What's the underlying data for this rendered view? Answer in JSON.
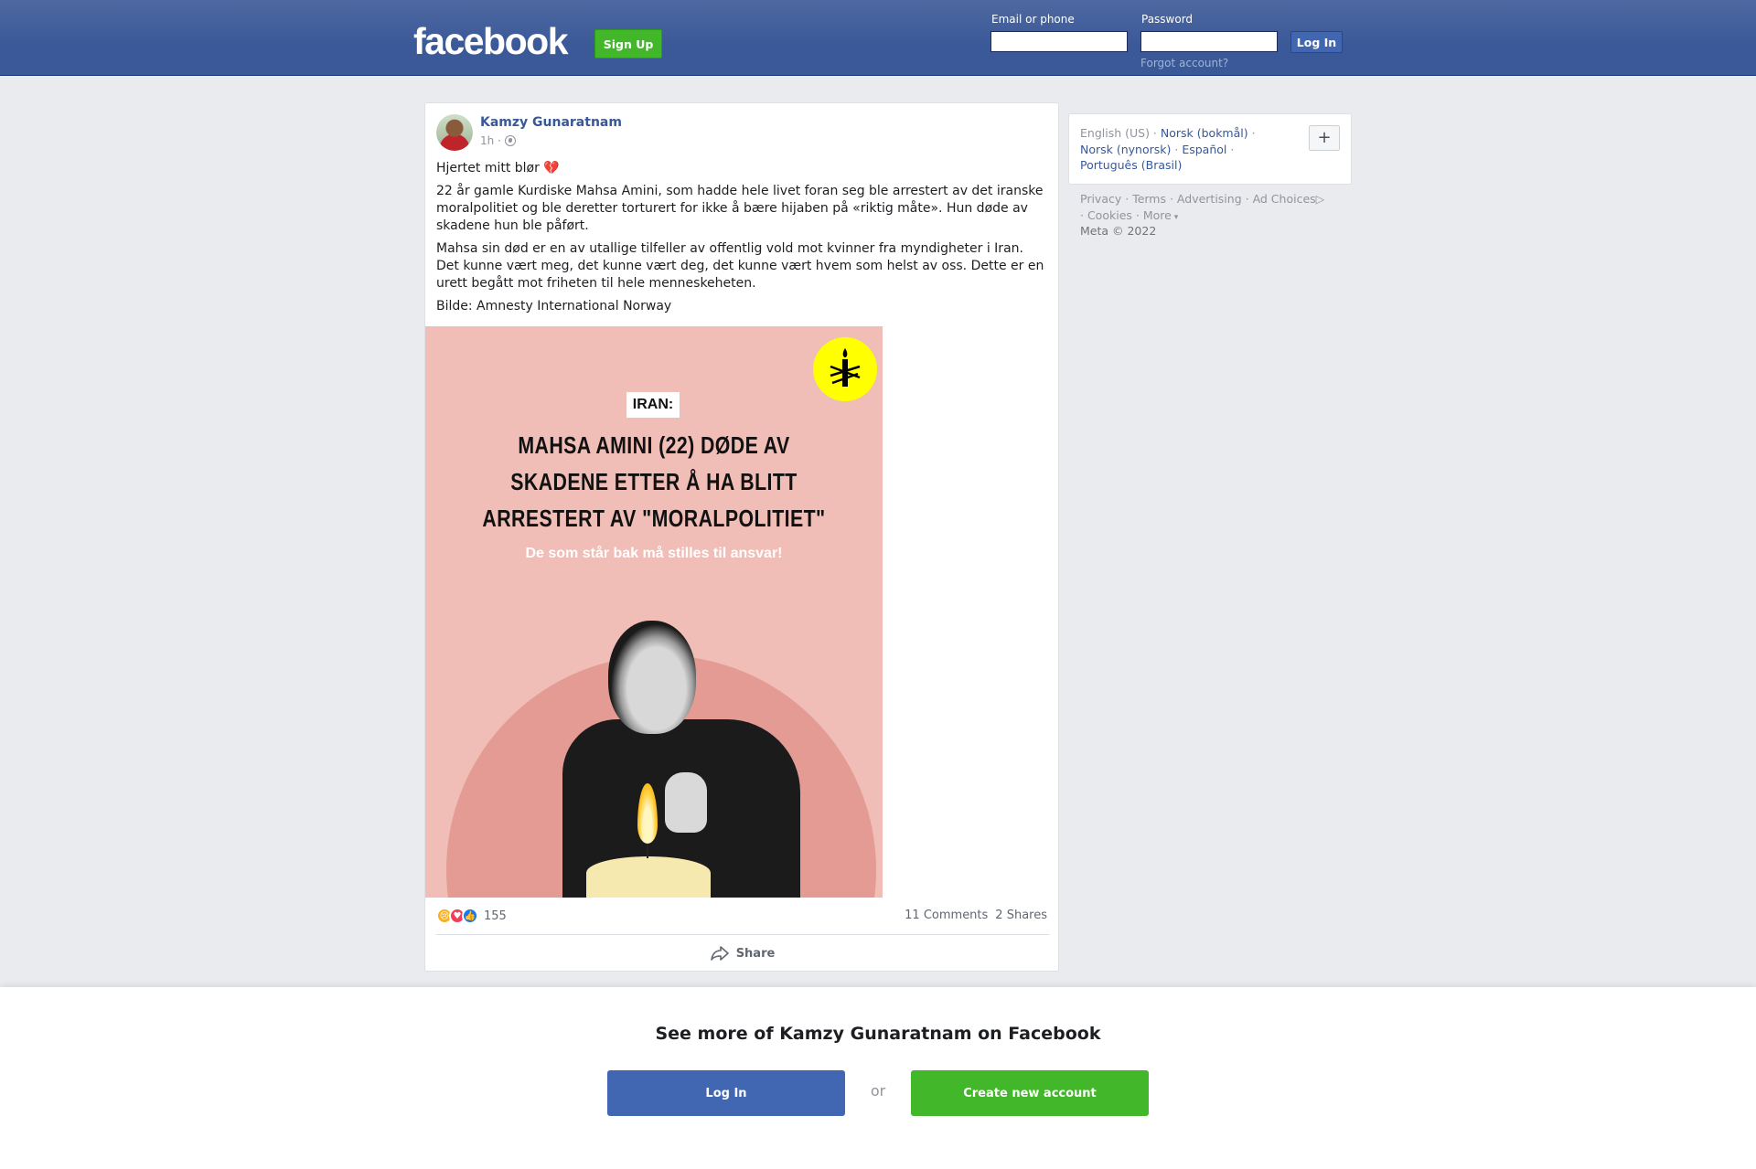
{
  "header": {
    "logo": "facebook",
    "signup_label": "Sign Up",
    "email_label": "Email or phone",
    "password_label": "Password",
    "login_label": "Log In",
    "forgot_label": "Forgot account?"
  },
  "post": {
    "author": "Kamzy Gunaratnam",
    "time": "1h ·",
    "paragraphs": [
      "Hjertet mitt blør 💔",
      "22 år gamle Kurdiske Mahsa Amini, som hadde hele livet foran seg ble arrestert av det iranske moralpolitiet og ble deretter torturert for ikke å bære hijaben på «riktig måte». Hun døde av skadene hun ble påført.",
      "Mahsa sin død er en av utallige tilfeller av offentlig vold mot kvinner fra myndigheter i Iran. Det kunne vært meg, det kunne vært deg, det kunne vært hvem som helst av oss. Dette er en urett begått mot friheten til hele menneskeheten.",
      "Bilde: Amnesty International Norway"
    ],
    "image": {
      "tag": "IRAN:",
      "headline": "MAHSA AMINI (22) DØDE AV SKADENE ETTER Å HA BLITT ARRESTERT AV \"MORALPOLITIET\"",
      "subline": "De som står bak må stilles til ansvar!"
    },
    "reaction_count": "155",
    "comments": "11 Comments",
    "shares": "2 Shares",
    "share_label": "Share"
  },
  "sidebar": {
    "current_language": "English (US)",
    "languages": [
      "Norsk (bokmål)",
      "Norsk (nynorsk)",
      "Español",
      "Português (Brasil)"
    ],
    "plus_label": "+",
    "footer_links": [
      "Privacy",
      "Terms",
      "Advertising",
      "Ad Choices",
      "Cookies",
      "More"
    ],
    "copyright": "Meta © 2022"
  },
  "bottom_bar": {
    "title": "See more of Kamzy Gunaratnam on Facebook",
    "login_label": "Log In",
    "or_label": "or",
    "create_label": "Create new account"
  },
  "colors": {
    "header_blue": "#3b5998",
    "signup_green": "#42b72a",
    "link_blue": "#385898",
    "poster_pink": "#f0beb6",
    "amnesty_yellow": "#ffff00"
  }
}
